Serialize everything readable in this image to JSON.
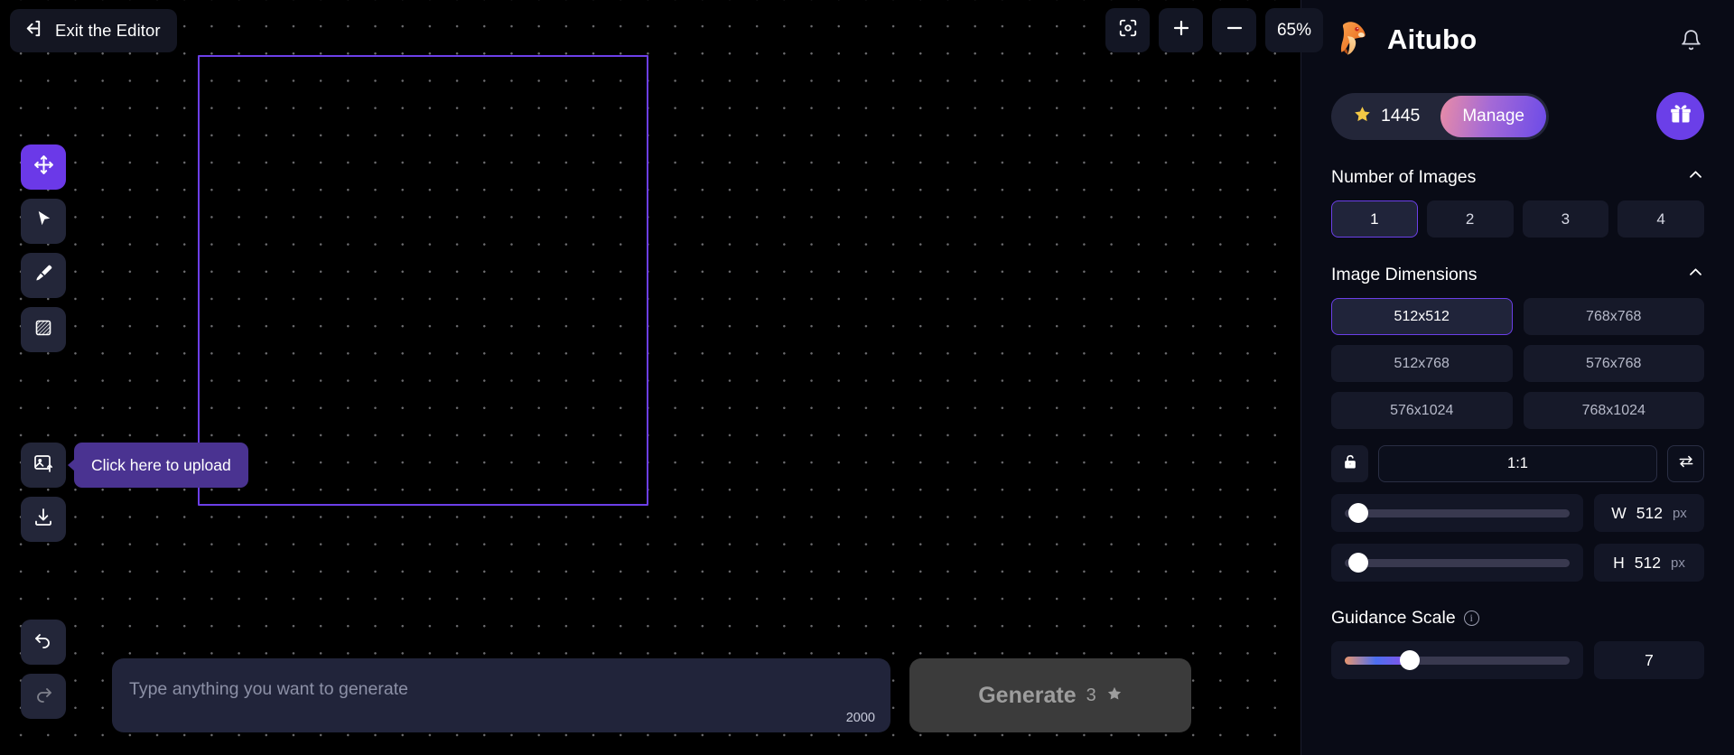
{
  "editor": {
    "exit_label": "Exit the Editor",
    "exit_icon": "arrow-left-exit-icon",
    "zoom_level": "65%",
    "zoom_fit_icon": "fit-to-screen-icon",
    "zoom_in_icon": "plus-icon",
    "zoom_out_icon": "minus-icon"
  },
  "tools": [
    {
      "name": "move-tool",
      "icon": "move-arrows-icon",
      "active": true
    },
    {
      "name": "select-tool",
      "icon": "cursor-arrow-icon",
      "active": false
    },
    {
      "name": "brush-tool",
      "icon": "paint-brush-icon",
      "active": false
    },
    {
      "name": "mask-tool",
      "icon": "hatched-square-icon",
      "active": false
    },
    {
      "name": "upload-tool",
      "icon": "image-upload-icon",
      "active": false
    },
    {
      "name": "download-tool",
      "icon": "download-icon",
      "active": false
    },
    {
      "name": "undo-tool",
      "icon": "undo-arrow-icon",
      "active": false
    },
    {
      "name": "redo-tool",
      "icon": "redo-arrow-icon",
      "active": false
    }
  ],
  "tooltip": {
    "upload_text": "Click here to upload"
  },
  "prompt": {
    "placeholder": "Type anything you want to generate",
    "value": "",
    "char_limit": "2000"
  },
  "generate": {
    "label": "Generate",
    "cost": "3",
    "cost_icon": "star-icon",
    "enabled": false
  },
  "brand": {
    "name": "Aitubo",
    "logo_icon": "beaver-head-logo",
    "bell_icon": "notification-bell-icon"
  },
  "credits": {
    "star_icon": "star-icon",
    "amount": "1445",
    "manage_label": "Manage",
    "gift_icon": "gift-box-icon"
  },
  "number_of_images": {
    "title": "Number of Images",
    "collapse_icon": "chevron-up-icon",
    "options": [
      "1",
      "2",
      "3",
      "4"
    ],
    "selected": "1"
  },
  "image_dimensions": {
    "title": "Image Dimensions",
    "collapse_icon": "chevron-up-icon",
    "options": [
      "512x512",
      "768x768",
      "512x768",
      "576x768",
      "576x1024",
      "768x1024"
    ],
    "selected": "512x512",
    "lock_icon": "unlocked-padlock-icon",
    "aspect_ratio": "1:1",
    "swap_icon": "swap-arrows-icon",
    "width": {
      "key": "W",
      "value": "512",
      "unit": "px",
      "percent": 6
    },
    "height": {
      "key": "H",
      "value": "512",
      "unit": "px",
      "percent": 6
    }
  },
  "guidance_scale": {
    "title": "Guidance Scale",
    "info_icon": "info-circle-icon",
    "info_glyph": "i",
    "value": "7",
    "percent": 29
  },
  "colors": {
    "accent": "#6b3fe8",
    "panel_bg": "#090b16",
    "canvas_bg": "#000000",
    "selection_border": "#6c3fe8",
    "tooltip_bg": "#4a3391"
  }
}
